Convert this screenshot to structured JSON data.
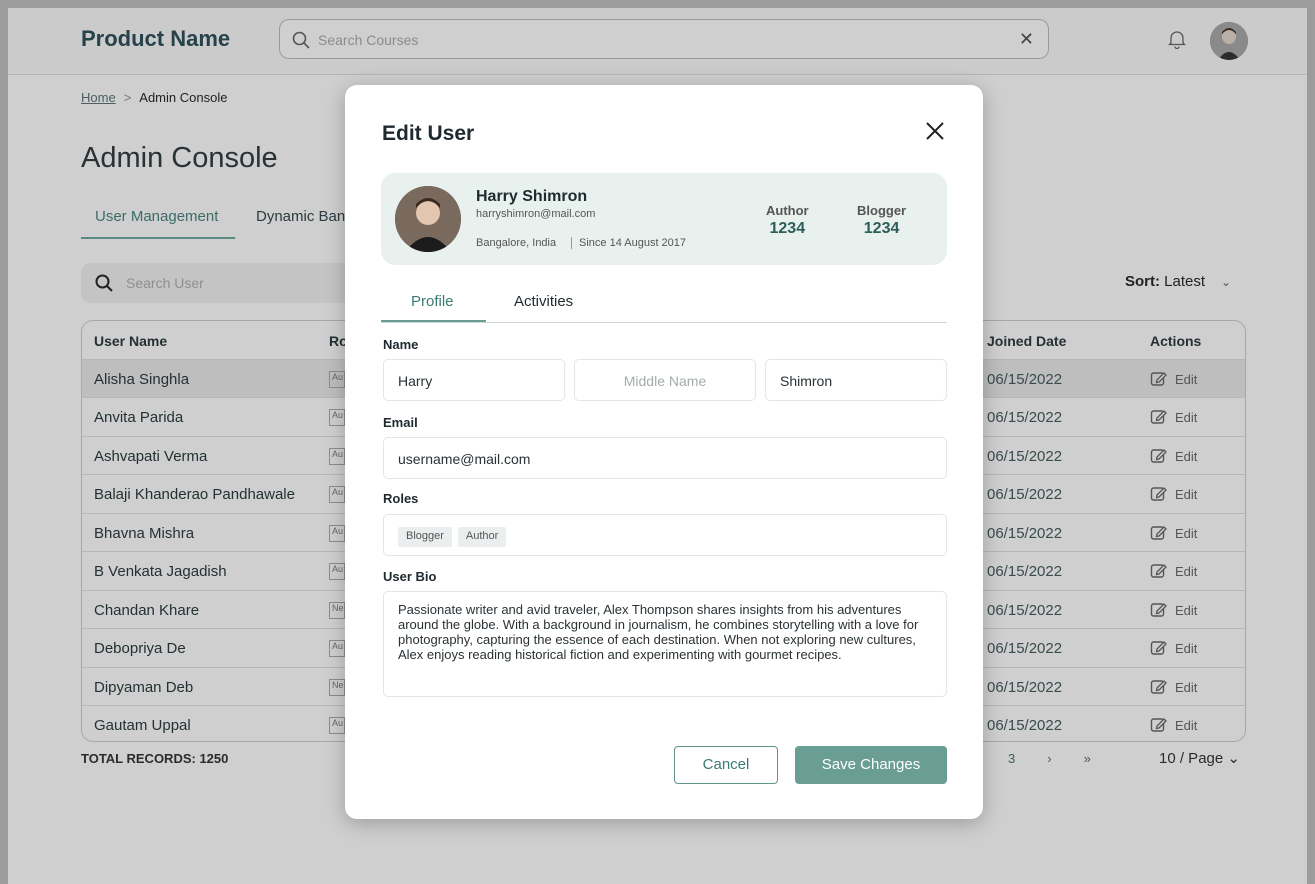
{
  "header": {
    "brand": "Product Name",
    "search_placeholder": "Search Courses"
  },
  "breadcrumb": {
    "home": "Home",
    "sep": ">",
    "current": "Admin Console"
  },
  "page_title": "Admin Console",
  "tabs": [
    "User Management",
    "Dynamic Ban"
  ],
  "user_search_placeholder": "Search User",
  "sort": {
    "label": "Sort:",
    "value": "Latest"
  },
  "table": {
    "headers": {
      "name": "User Name",
      "role": "Ro",
      "joined": "Joined Date",
      "actions": "Actions"
    },
    "rows": [
      {
        "name": "Alisha Singhla",
        "chip": "Au",
        "date": "06/15/2022"
      },
      {
        "name": "Anvita Parida",
        "chip": "Au",
        "date": "06/15/2022"
      },
      {
        "name": "Ashvapati Verma",
        "chip": "Au",
        "date": "06/15/2022"
      },
      {
        "name": "Balaji Khanderao Pandhawale",
        "chip": "Au",
        "date": "06/15/2022"
      },
      {
        "name": "Bhavna Mishra",
        "chip": "Au",
        "date": "06/15/2022"
      },
      {
        "name": "B Venkata Jagadish",
        "chip": "Au",
        "date": "06/15/2022"
      },
      {
        "name": "Chandan Khare",
        "chip": "Ne",
        "date": "06/15/2022"
      },
      {
        "name": "Debopriya De",
        "chip": "Au",
        "date": "06/15/2022"
      },
      {
        "name": "Dipyaman Deb",
        "chip": "Ne",
        "date": "06/15/2022"
      },
      {
        "name": "Gautam Uppal",
        "chip": "Au",
        "date": "06/15/2022"
      }
    ],
    "edit_label": "Edit"
  },
  "footer": {
    "total": "TOTAL RECORDS: 1250",
    "pager": [
      "3",
      "›",
      "»"
    ],
    "per_page": "10 / Page"
  },
  "modal": {
    "title": "Edit User",
    "user": {
      "name": "Harry Shimron",
      "email": "harryshimron@mail.com",
      "location": "Bangalore, India",
      "since": "Since 14 August 2017",
      "stats": [
        {
          "label": "Author",
          "value": "1234"
        },
        {
          "label": "Blogger",
          "value": "1234"
        }
      ]
    },
    "tabs": [
      "Profile",
      "Activities"
    ],
    "fields": {
      "name_label": "Name",
      "first_name": "Harry",
      "middle_name_placeholder": "Middle Name",
      "last_name": "Shimron",
      "email_label": "Email",
      "email": "username@mail.com",
      "roles_label": "Roles",
      "roles": [
        "Blogger",
        "Author"
      ],
      "bio_label": "User Bio",
      "bio": "Passionate writer and avid traveler, Alex Thompson shares insights from his adventures around the globe. With a background in journalism, he combines storytelling with a love for photography, capturing the essence of each destination. When not exploring new cultures, Alex enjoys reading historical fiction and experimenting with gourmet recipes."
    },
    "buttons": {
      "cancel": "Cancel",
      "save": "Save Changes"
    }
  }
}
